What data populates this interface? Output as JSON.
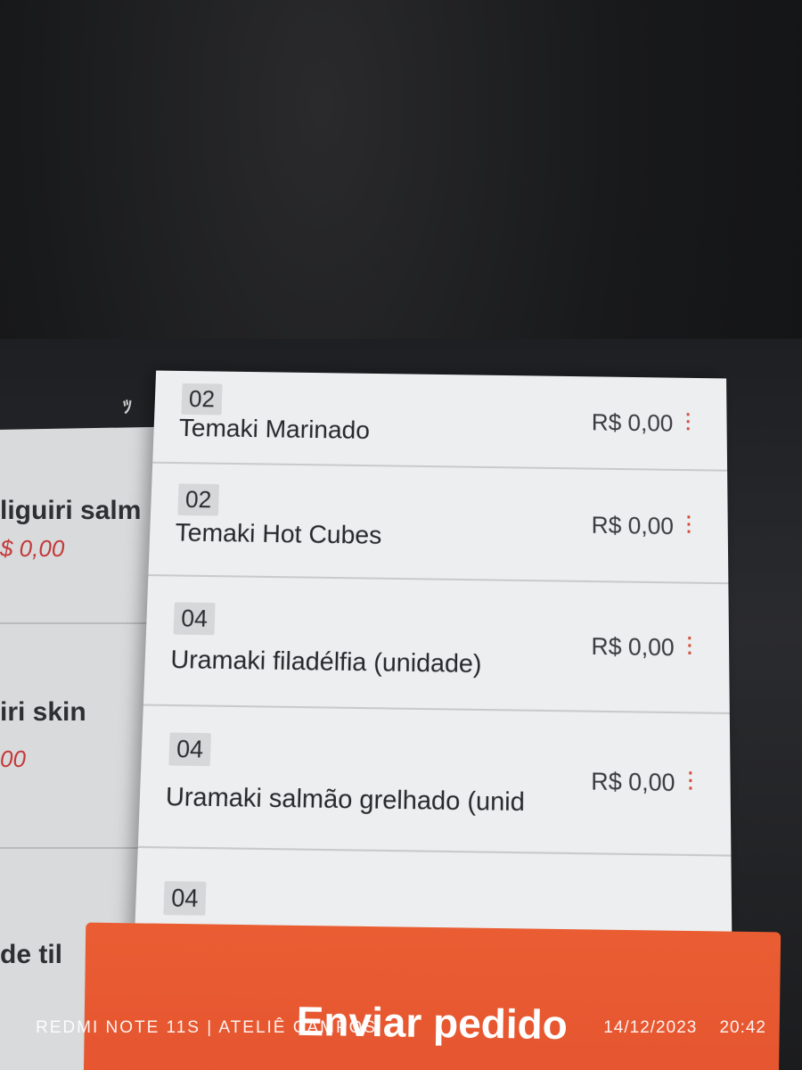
{
  "background_list": {
    "items": [
      {
        "name": "liguiri salm",
        "price": "$ 0,00"
      },
      {
        "name": "iri skin",
        "price": "00"
      },
      {
        "name": "de til",
        "price": ""
      }
    ]
  },
  "order": {
    "items": [
      {
        "qty": "02",
        "name": "Temaki Marinado",
        "price": "R$ 0,00"
      },
      {
        "qty": "02",
        "name": "Temaki Hot Cubes",
        "price": "R$ 0,00"
      },
      {
        "qty": "04",
        "name": "Uramaki filadélfia (unidade)",
        "price": "R$ 0,00"
      },
      {
        "qty": "04",
        "name": "Uramaki salmão grelhado (unid",
        "price": "R$ 0,00"
      },
      {
        "qty": "04",
        "name": "",
        "price": ""
      }
    ],
    "submit_label": "Enviar pedido"
  },
  "watermark": {
    "device": "REDMI NOTE 11S | ATELIÊ CAMPOS",
    "date": "14/12/2023",
    "time": "20:42"
  },
  "colors": {
    "accent": "#e8582f",
    "price_red": "#c43a3a",
    "menu_dots": "#d34b3a",
    "panel_bg": "#eceeef"
  }
}
